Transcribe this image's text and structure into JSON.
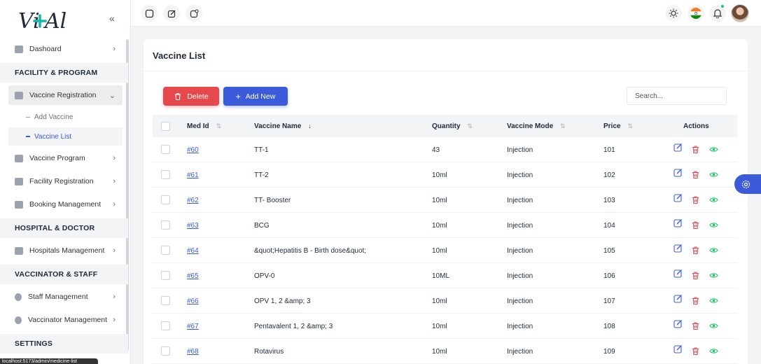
{
  "sidebar": {
    "logo_text": "ViAl",
    "collapse_glyph": "«",
    "items": {
      "dashboard": "Dashoard",
      "vaccine_registration": "Vaccine Registration",
      "add_vaccine": "Add Vaccine",
      "vaccine_list": "Vaccine List",
      "vaccine_program": "Vaccine Program",
      "facility_registration": "Facility Registration",
      "booking_management": "Booking Management",
      "hospitals_management": "Hospitals Management",
      "staff_management": "Staff Management",
      "vaccinator_management": "Vaccinator Management"
    },
    "sections": {
      "facility": "FACILITY & PROGRAM",
      "hospital": "HOSPITAL & DOCTOR",
      "vaccinator": "VACCINATOR & STAFF",
      "settings": "SETTINGS"
    },
    "status_url": "localhost:5173/admin/medicine-list"
  },
  "page": {
    "title": "Vaccine List",
    "delete_label": "Delete",
    "add_label": "Add New",
    "search_placeholder": "Search..."
  },
  "table": {
    "headers": {
      "med_id": "Med Id",
      "vaccine_name": "Vaccine Name",
      "quantity": "Quantity",
      "vaccine_mode": "Vaccine Mode",
      "price": "Price",
      "actions": "Actions"
    },
    "rows": [
      {
        "id": "#60",
        "name": "TT-1",
        "qty": "43",
        "mode": "Injection",
        "price": "101"
      },
      {
        "id": "#61",
        "name": "TT-2",
        "qty": "10ml",
        "mode": "Injection",
        "price": "102"
      },
      {
        "id": "#62",
        "name": "TT- Booster",
        "qty": "10ml",
        "mode": "Injection",
        "price": "103"
      },
      {
        "id": "#63",
        "name": "BCG",
        "qty": "10ml",
        "mode": "Injection",
        "price": "104"
      },
      {
        "id": "#64",
        "name": "&quot;Hepatitis B - Birth dose&quot;",
        "qty": "10ml",
        "mode": "Injection",
        "price": "105"
      },
      {
        "id": "#65",
        "name": "OPV-0",
        "qty": "10ML",
        "mode": "Injection",
        "price": "106"
      },
      {
        "id": "#66",
        "name": "OPV 1, 2 &amp; 3",
        "qty": "10ml",
        "mode": "Injection",
        "price": "107"
      },
      {
        "id": "#67",
        "name": "Pentavalent 1, 2 &amp; 3",
        "qty": "10ml",
        "mode": "Injection",
        "price": "108"
      },
      {
        "id": "#68",
        "name": "Rotavirus",
        "qty": "10ml",
        "mode": "Injection",
        "price": "109"
      }
    ]
  },
  "colors": {
    "primary": "#3b5bdb",
    "danger": "#e5484d",
    "success": "#22c55e"
  }
}
